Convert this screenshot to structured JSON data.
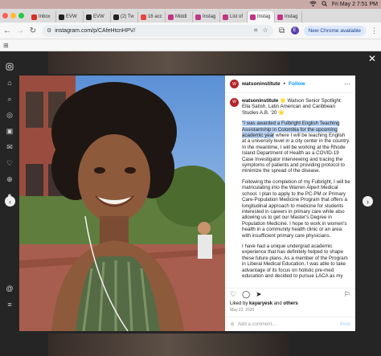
{
  "menubar": {
    "datetime": "Fri May 2  7:51 PM"
  },
  "tabs": [
    {
      "label": "Inbox",
      "color": "#d93025"
    },
    {
      "label": "EVW",
      "color": "#222222"
    },
    {
      "label": "EVW",
      "color": "#222222"
    },
    {
      "label": "(2) Tw",
      "color": "#222222"
    },
    {
      "label": "16 acc",
      "color": "#e8453c"
    },
    {
      "label": "Middl",
      "color": "#c13584"
    },
    {
      "label": "Instag",
      "color": "#c13584"
    },
    {
      "label": "List of",
      "color": "#c13584"
    },
    {
      "label": "Instag",
      "color": "#c13584",
      "active": true
    },
    {
      "label": "Instag",
      "color": "#c13584"
    }
  ],
  "address": {
    "url": "instagram.com/p/CAfeHtcnHPV/",
    "profile_initial": "E",
    "chrome_pill": "New Chrome available"
  },
  "post": {
    "username": "watsoninstitute",
    "follow": "Follow",
    "caption_user": "watsoninstitute",
    "caption_intro": "🌟 Watson Senior Spotlight: Ella Satish, Latin American and Caribbean Studies A.B. '20 🌟",
    "caption_highlight": "\"I was awarded a Fulbright English Teaching Assistantship in Colombia for the upcoming academic year",
    "caption_rest1": " where I will be teaching English at a university level in a city center in the country. In the meantime, I will be working at the Rhode Island Department of Health as a COVID-19 Case Investigator interviewing and tracing the symptoms of patients and providing protocol to minimize the spread of the disease.",
    "caption_p2": "Following the completion of my Fulbright, I will be matriculating into the Warren Alpert Medical school. I plan to apply to the PC-PM or Primary Care-Population Medicine Program that offers a longitudinal approach to medicine for students interested in careers in primary care while also allowing us to get our Master's Degree in Population Medicine. I hope to work in women's health in a community health clinic or an area with insufficient primary care physicians.",
    "caption_p3": "I have had a unique undergrad academic experience that has definitely helped to shape these future plans. As a member of the Program in Liberal Medical Education, I was able to take advantage of its focus on holistic pre-med education and decided to pursue LACA as my",
    "liked_prefix": "Liked by ",
    "liked_user": "kayaryesk",
    "liked_mid": " and ",
    "liked_others": "others",
    "date": "May 22, 2020",
    "comment_placeholder": "Add a comment...",
    "post_btn": "Post"
  }
}
